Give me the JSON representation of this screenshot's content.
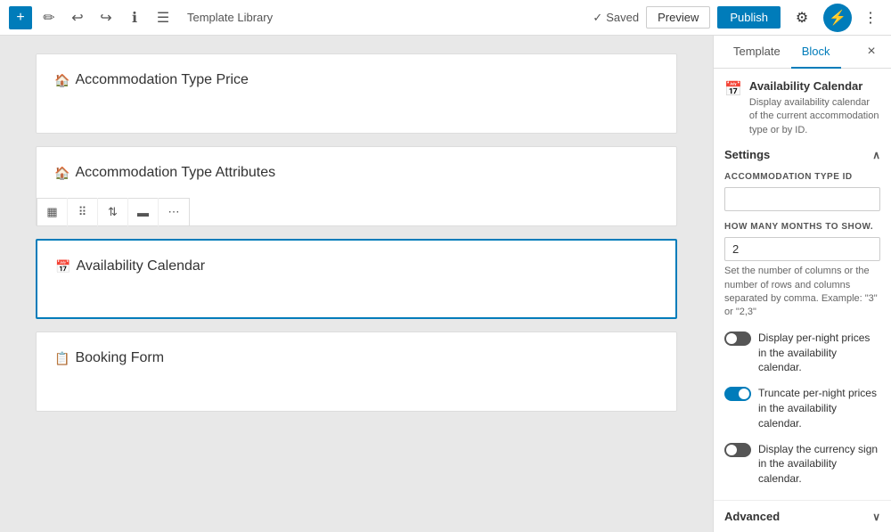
{
  "topbar": {
    "title": "Template Library",
    "saved_label": "Saved",
    "preview_label": "Preview",
    "publish_label": "Publish"
  },
  "editor": {
    "blocks": [
      {
        "id": "accommodation-type-price",
        "title": "Accommodation Type Price",
        "icon": "🏠",
        "selected": false,
        "show_toolbar": false
      },
      {
        "id": "accommodation-type-attributes",
        "title": "Accommodation Type Attributes",
        "icon": "🏠",
        "selected": false,
        "show_toolbar": true
      },
      {
        "id": "availability-calendar",
        "title": "Availability Calendar",
        "icon": "📅",
        "selected": true,
        "show_toolbar": false
      },
      {
        "id": "booking-form",
        "title": "Booking Form",
        "icon": "📋",
        "selected": false,
        "show_toolbar": false
      }
    ]
  },
  "side_panel": {
    "tabs": [
      "Template",
      "Block"
    ],
    "active_tab": "Block",
    "block_info": {
      "title": "Availability Calendar",
      "description": "Display availability calendar of the current accommodation type or by ID."
    },
    "settings_label": "Settings",
    "accommodation_type_id_label": "ACCOMMODATION TYPE ID",
    "accommodation_type_id_value": "",
    "accommodation_type_id_placeholder": "",
    "months_label": "HOW MANY MONTHS TO SHOW.",
    "months_value": "2",
    "months_help": "Set the number of columns or the number of rows and columns separated by comma. Example: \"3\" or \"2,3\"",
    "toggles": [
      {
        "id": "display-per-night",
        "label": "Display per-night prices in the availability calendar.",
        "state": "off"
      },
      {
        "id": "truncate-per-night",
        "label": "Truncate per-night prices in the availability calendar.",
        "state": "on"
      },
      {
        "id": "display-currency",
        "label": "Display the currency sign in the availability calendar.",
        "state": "off"
      }
    ],
    "advanced_label": "Advanced"
  },
  "toolbar_buttons": [
    "grid",
    "dots",
    "arrows",
    "square",
    "more"
  ]
}
